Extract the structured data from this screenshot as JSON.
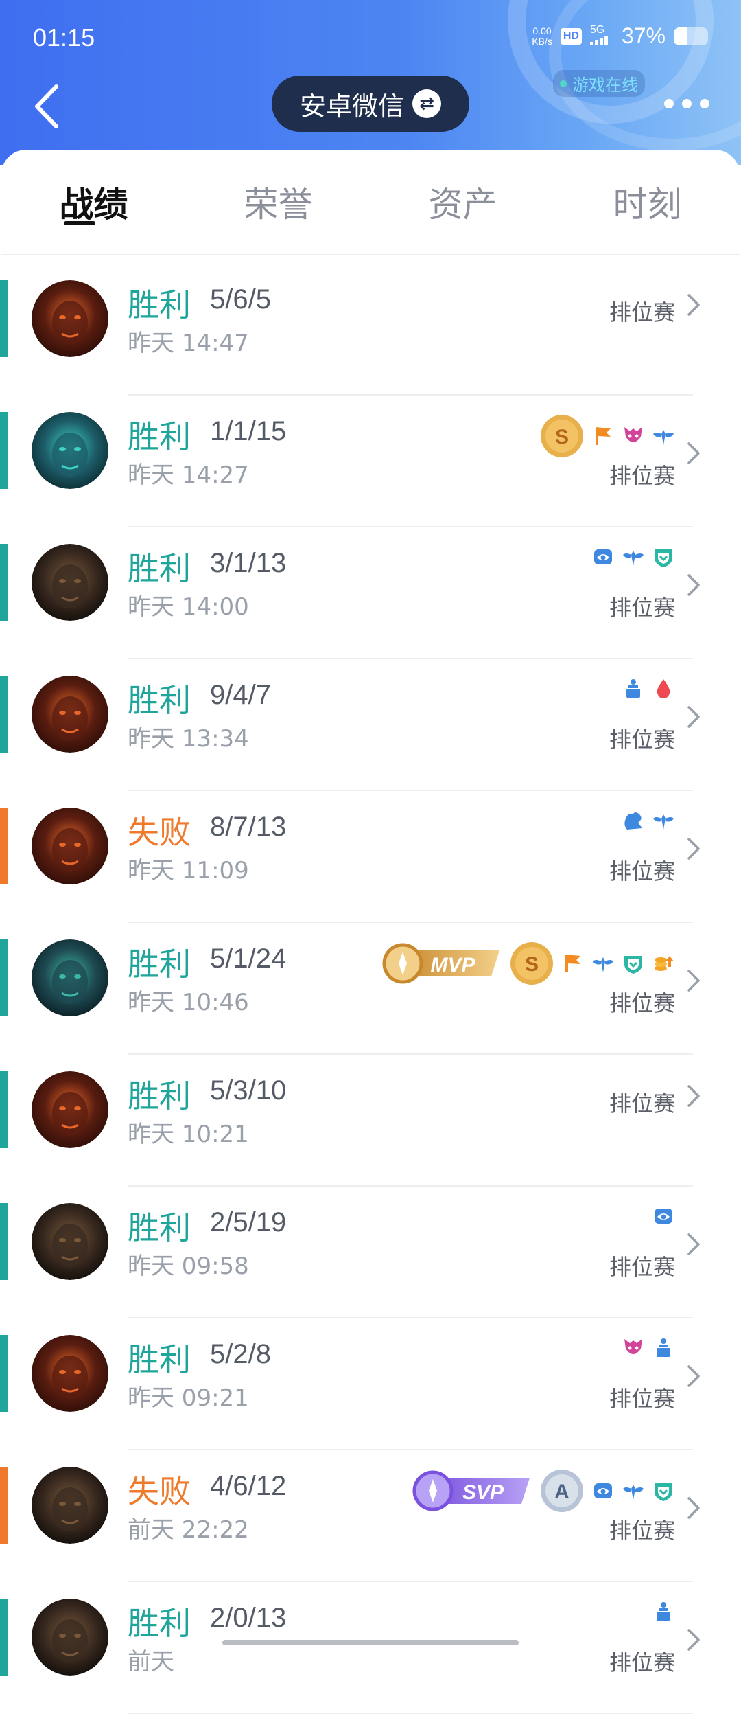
{
  "status_bar": {
    "time": "01:15",
    "net_speed_top": "0.00",
    "net_speed_unit": "KB/s",
    "hd": "HD",
    "network": "5G",
    "battery_text": "37%",
    "battery_level": 0.37
  },
  "header": {
    "account_label": "安卓微信",
    "online_text": "游戏在线"
  },
  "tabs": [
    {
      "label": "战绩",
      "active": true
    },
    {
      "label": "荣誉"
    },
    {
      "label": "资产"
    },
    {
      "label": "时刻"
    }
  ],
  "colors": {
    "win": "#1fa59a",
    "lose": "#ef7a2c",
    "header_blue": "#4d86f2"
  },
  "matches": [
    {
      "result": "胜利",
      "outcome": "win",
      "kda": "5/6/5",
      "time": "昨天 14:47",
      "mode": "排位赛",
      "hero": "hero-a",
      "badges": []
    },
    {
      "result": "胜利",
      "outcome": "win",
      "kda": "1/1/15",
      "time": "昨天 14:27",
      "mode": "排位赛",
      "hero": "hero-b",
      "badges": [
        "s-medal",
        "flag-icon",
        "demon-icon",
        "wings-icon"
      ]
    },
    {
      "result": "胜利",
      "outcome": "win",
      "kda": "3/1/13",
      "time": "昨天 14:00",
      "mode": "排位赛",
      "hero": "hero-c",
      "badges": [
        "eye-icon",
        "wings-icon",
        "shield-icon"
      ]
    },
    {
      "result": "胜利",
      "outcome": "win",
      "kda": "9/4/7",
      "time": "昨天 13:34",
      "mode": "排位赛",
      "hero": "hero-a",
      "badges": [
        "tower-icon",
        "blood-icon"
      ]
    },
    {
      "result": "失败",
      "outcome": "lose",
      "kda": "8/7/13",
      "time": "昨天 11:09",
      "mode": "排位赛",
      "hero": "hero-a",
      "badges": [
        "hand-icon",
        "wings-icon"
      ]
    },
    {
      "result": "胜利",
      "outcome": "win",
      "kda": "5/1/24",
      "time": "昨天 10:46",
      "mode": "排位赛",
      "hero": "hero-d",
      "badges": [
        "mvp",
        "s-medal",
        "flag-icon",
        "wings-icon",
        "shield-icon",
        "coins-icon"
      ]
    },
    {
      "result": "胜利",
      "outcome": "win",
      "kda": "5/3/10",
      "time": "昨天 10:21",
      "mode": "排位赛",
      "hero": "hero-a",
      "badges": []
    },
    {
      "result": "胜利",
      "outcome": "win",
      "kda": "2/5/19",
      "time": "昨天 09:58",
      "mode": "排位赛",
      "hero": "hero-c",
      "badges": [
        "eye-icon"
      ]
    },
    {
      "result": "胜利",
      "outcome": "win",
      "kda": "5/2/8",
      "time": "昨天 09:21",
      "mode": "排位赛",
      "hero": "hero-a",
      "badges": [
        "demon-icon",
        "tower-icon"
      ]
    },
    {
      "result": "失败",
      "outcome": "lose",
      "kda": "4/6/12",
      "time": "前天 22:22",
      "mode": "排位赛",
      "hero": "hero-c",
      "badges": [
        "svp",
        "a-medal",
        "eye-icon",
        "wings-icon",
        "shield-icon"
      ]
    },
    {
      "result": "胜利",
      "outcome": "win",
      "kda": "2/0/13",
      "time": "前天",
      "mode": "排位赛",
      "hero": "hero-c",
      "badges": [
        "tower-icon"
      ]
    }
  ],
  "badge_text": {
    "mvp": "MVP",
    "svp": "SVP",
    "s": "S",
    "a": "A"
  }
}
